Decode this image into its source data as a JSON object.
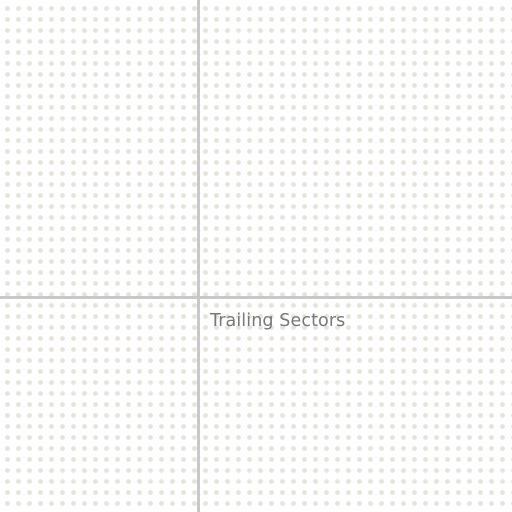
{
  "quadrants": {
    "bottom_right": {
      "label": "Trailing Sectors"
    }
  },
  "colors": {
    "background": "#ffffff",
    "dot": "#e6e4dc",
    "axis": "#c8c8c8",
    "label": "#787878"
  }
}
